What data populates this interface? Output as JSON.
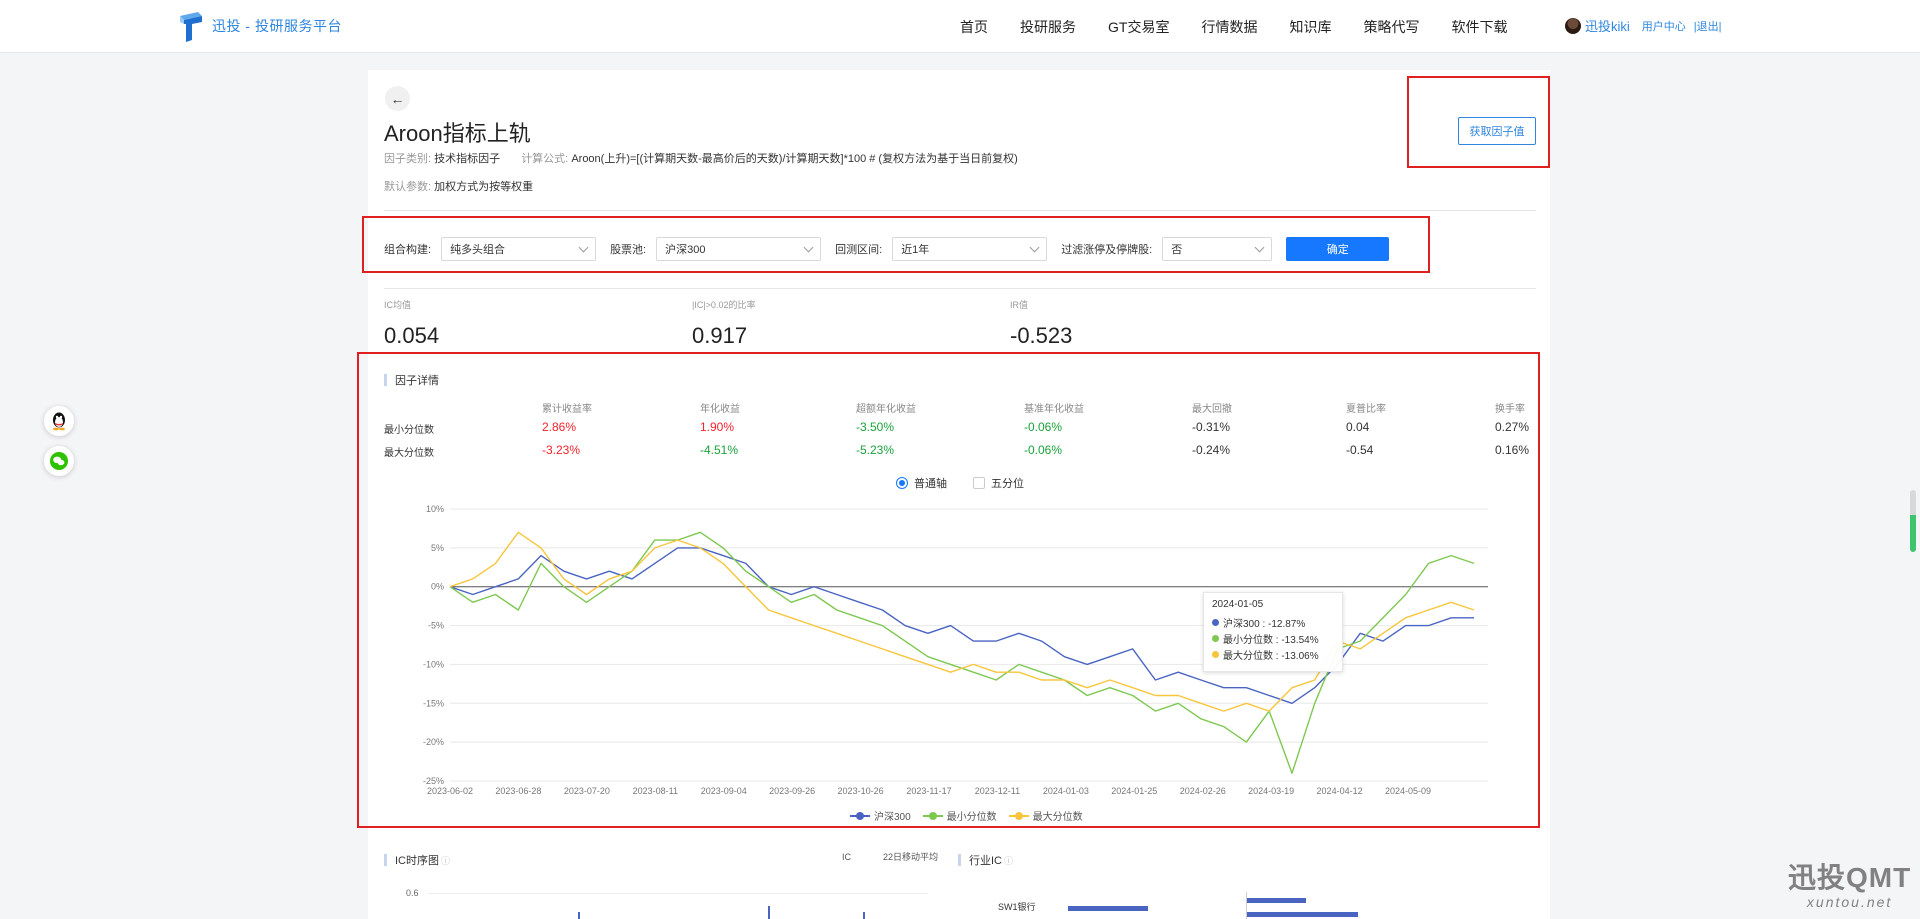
{
  "header": {
    "logo_text": "迅投 - 投研服务平台",
    "nav": [
      "首页",
      "投研服务",
      "GT交易室",
      "行情数据",
      "知识库",
      "策略代写",
      "软件下载"
    ],
    "user_name": "迅投kiki",
    "user_center": "用户中心",
    "logout": "|退出|"
  },
  "factor": {
    "title": "Aroon指标上轨",
    "category_label": "因子类别:",
    "category_value": "技术指标因子",
    "formula_label": "计算公式:",
    "formula_value": "Aroon(上升)=[(计算期天数-最高价后的天数)/计算期天数]*100 # (复权方法为基于当日前复权)",
    "params_label": "默认参数:",
    "params_value": "加权方式为按等权重",
    "get_value_button": "获取因子值"
  },
  "filters": {
    "portfolio_label": "组合构建:",
    "portfolio_value": "纯多头组合",
    "pool_label": "股票池:",
    "pool_value": "沪深300",
    "period_label": "回测区间:",
    "period_value": "近1年",
    "exclude_label": "过滤涨停及停牌股:",
    "exclude_value": "否",
    "confirm": "确定"
  },
  "stats": [
    {
      "label": "IC均值",
      "value": "0.054"
    },
    {
      "label": "|IC|>0.02的比率",
      "value": "0.917"
    },
    {
      "label": "IR值",
      "value": "-0.523"
    }
  ],
  "detail": {
    "title": "因子详情",
    "columns": [
      "累计收益率",
      "年化收益",
      "超额年化收益",
      "基准年化收益",
      "最大回撤",
      "夏普比率",
      "换手率"
    ],
    "rows": [
      {
        "name": "最小分位数",
        "values": [
          "2.86%",
          "1.90%",
          "-3.50%",
          "-0.06%",
          "-0.31%",
          "0.04",
          "0.27%"
        ],
        "colors": [
          "red",
          "red",
          "green",
          "green",
          "",
          "",
          ""
        ]
      },
      {
        "name": "最大分位数",
        "values": [
          "-3.23%",
          "-4.51%",
          "-5.23%",
          "-0.06%",
          "-0.24%",
          "-0.54",
          "0.16%"
        ],
        "colors": [
          "red",
          "green",
          "green",
          "green",
          "",
          "",
          ""
        ]
      }
    ],
    "toggle_normal": "普通轴",
    "toggle_quintile": "五分位"
  },
  "tooltip": {
    "date": "2024-01-05",
    "rows": [
      {
        "label": "沪深300 : -12.87%",
        "color": "#4a64c2"
      },
      {
        "label": "最小分位数 : -13.54%",
        "color": "#7ec850"
      },
      {
        "label": "最大分位数 : -13.06%",
        "color": "#f7c53c"
      }
    ]
  },
  "chart_data": {
    "type": "line",
    "y_ticks": [
      "10%",
      "5%",
      "0%",
      "-5%",
      "-10%",
      "-15%",
      "-20%",
      "-25%"
    ],
    "ylim": [
      -25,
      10
    ],
    "x_ticks": [
      "2023-06-02",
      "2023-06-28",
      "2023-07-20",
      "2023-08-11",
      "2023-09-04",
      "2023-09-26",
      "2023-10-26",
      "2023-11-17",
      "2023-12-11",
      "2024-01-03",
      "2024-01-25",
      "2024-02-26",
      "2024-03-19",
      "2024-04-12",
      "2024-05-09"
    ],
    "grid": "horizontal",
    "legend_position": "bottom",
    "series": [
      {
        "name": "沪深300",
        "color": "#4a64c2",
        "values": [
          0,
          -1,
          0,
          1,
          4,
          2,
          1,
          2,
          1,
          3,
          5,
          5,
          4,
          3,
          0,
          -1,
          0,
          -1,
          -2,
          -3,
          -5,
          -6,
          -5,
          -7,
          -7,
          -6,
          -7,
          -9,
          -10,
          -9,
          -8,
          -12,
          -11,
          -12,
          -13,
          -13,
          -14,
          -15,
          -13,
          -10,
          -6,
          -7,
          -5,
          -5,
          -4,
          -4
        ]
      },
      {
        "name": "最小分位数",
        "color": "#7ec850",
        "values": [
          0,
          -2,
          -1,
          -3,
          3,
          0,
          -2,
          0,
          2,
          6,
          6,
          7,
          5,
          2,
          0,
          -2,
          -1,
          -3,
          -4,
          -5,
          -7,
          -9,
          -10,
          -11,
          -12,
          -10,
          -11,
          -12,
          -14,
          -13,
          -14,
          -16,
          -15,
          -17,
          -18,
          -20,
          -16,
          -24,
          -15,
          -8,
          -7,
          -4,
          -1,
          3,
          4,
          3
        ]
      },
      {
        "name": "最大分位数",
        "color": "#f7c53c",
        "values": [
          0,
          1,
          3,
          7,
          5,
          1,
          -1,
          1,
          2,
          5,
          6,
          5,
          3,
          0,
          -3,
          -4,
          -5,
          -6,
          -7,
          -8,
          -9,
          -10,
          -11,
          -10,
          -11,
          -11,
          -12,
          -12,
          -13,
          -12,
          -13,
          -14,
          -14,
          -15,
          -16,
          -15,
          -16,
          -13,
          -12,
          -7,
          -8,
          -6,
          -4,
          -3,
          -2,
          -3
        ]
      }
    ]
  },
  "bottom": {
    "ic_title": "IC时序图",
    "ic_legend_ic": "IC",
    "ic_legend_ma": "22日移动平均",
    "ic_tick": "0.6",
    "industry_title": "行业IC",
    "industry_row1": "SW1银行"
  },
  "watermark": {
    "line1": "迅投QMT",
    "line2": "xuntou.net"
  }
}
